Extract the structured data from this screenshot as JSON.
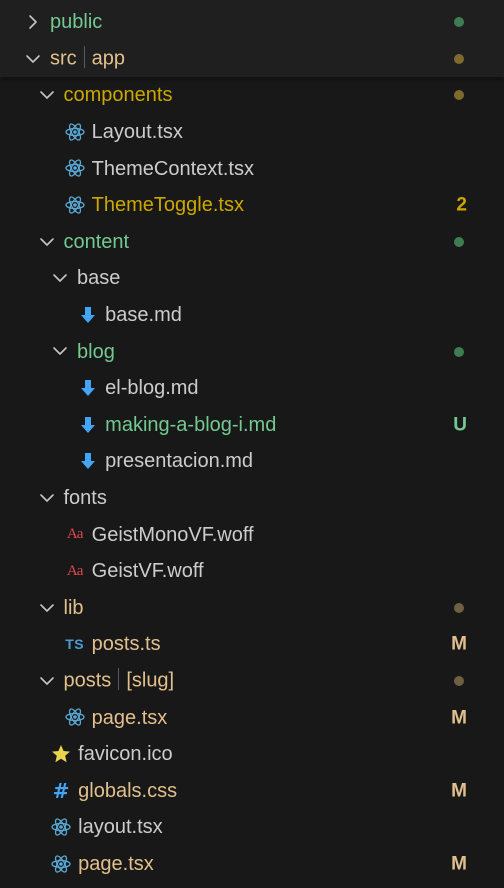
{
  "colors": {
    "default": "#cccccc",
    "untracked": "#73c991",
    "modified": "#e2c08d",
    "warning": "#cca700",
    "dot_green": "#3e7d52",
    "dot_yellow": "#7f6a2e",
    "dot_brown": "#6f6043"
  },
  "tree": [
    {
      "label": "public",
      "expanded": false,
      "color": "untracked",
      "dot": "dot_green",
      "icon": "chevron-right-icon",
      "sticky": true
    },
    {
      "label": "src",
      "label2": "app",
      "expanded": true,
      "color": "modified",
      "dot": "dot_yellow",
      "icon": "chevron-down-icon",
      "sticky": true
    },
    {
      "label": "components",
      "expanded": true,
      "color": "warning",
      "dot": "dot_yellow",
      "icon": "chevron-down-icon"
    },
    {
      "label": "Layout.tsx",
      "color": "default",
      "icon": "react-icon"
    },
    {
      "label": "ThemeContext.tsx",
      "color": "default",
      "icon": "react-icon"
    },
    {
      "label": "ThemeToggle.tsx",
      "color": "warning",
      "icon": "react-icon",
      "badge": "2"
    },
    {
      "label": "content",
      "expanded": true,
      "color": "untracked",
      "dot": "dot_green",
      "icon": "chevron-down-icon"
    },
    {
      "label": "base",
      "expanded": true,
      "color": "default",
      "icon": "chevron-down-icon"
    },
    {
      "label": "base.md",
      "color": "default",
      "icon": "markdown-icon"
    },
    {
      "label": "blog",
      "expanded": true,
      "color": "untracked",
      "dot": "dot_green",
      "icon": "chevron-down-icon"
    },
    {
      "label": "el-blog.md",
      "color": "default",
      "icon": "markdown-icon"
    },
    {
      "label": "making-a-blog-i.md",
      "color": "untracked",
      "icon": "markdown-icon",
      "badge": "U"
    },
    {
      "label": "presentacion.md",
      "color": "default",
      "icon": "markdown-icon"
    },
    {
      "label": "fonts",
      "expanded": true,
      "color": "default",
      "icon": "chevron-down-icon"
    },
    {
      "label": "GeistMonoVF.woff",
      "color": "default",
      "icon": "font-icon"
    },
    {
      "label": "GeistVF.woff",
      "color": "default",
      "icon": "font-icon"
    },
    {
      "label": "lib",
      "expanded": true,
      "color": "modified",
      "dot": "dot_brown",
      "icon": "chevron-down-icon"
    },
    {
      "label": "posts.ts",
      "color": "modified",
      "icon": "typescript-icon",
      "badge": "M"
    },
    {
      "label": "posts",
      "label2": "[slug]",
      "expanded": true,
      "color": "modified",
      "dot": "dot_brown",
      "icon": "chevron-down-icon"
    },
    {
      "label": "page.tsx",
      "color": "modified",
      "icon": "react-icon",
      "badge": "M"
    },
    {
      "label": "favicon.ico",
      "color": "default",
      "icon": "star-icon"
    },
    {
      "label": "globals.css",
      "color": "modified",
      "icon": "css-hash-icon",
      "badge": "M"
    },
    {
      "label": "layout.tsx",
      "color": "default",
      "icon": "react-icon"
    },
    {
      "label": "page.tsx",
      "color": "modified",
      "icon": "react-icon",
      "badge": "M"
    }
  ]
}
